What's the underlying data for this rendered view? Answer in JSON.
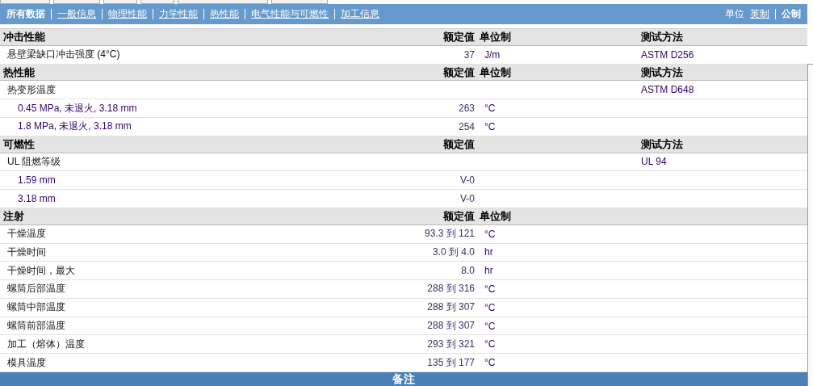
{
  "nav": {
    "items": [
      {
        "label": "所有数据",
        "selected": true
      },
      {
        "label": "一般信息",
        "selected": false
      },
      {
        "label": "物理性能",
        "selected": false
      },
      {
        "label": "力学性能",
        "selected": false
      },
      {
        "label": "热性能",
        "selected": false
      },
      {
        "label": "电气性能与可燃性",
        "selected": false
      },
      {
        "label": "加工信息",
        "selected": false
      }
    ],
    "units_label": "单位",
    "units": [
      {
        "label": "英制",
        "selected": false
      },
      {
        "label": "公制",
        "selected": true
      }
    ]
  },
  "sections": [
    {
      "title": "冲击性能",
      "value_header": "额定值",
      "unit_header": "单位制",
      "method_header": "测试方法",
      "rows": [
        {
          "name": "悬壁梁缺口冲击强度 (4°C)",
          "value": "37",
          "unit": "J/m",
          "method": "ASTM D256"
        }
      ]
    },
    {
      "title": "热性能",
      "value_header": "额定值",
      "unit_header": "单位制",
      "method_header": "测试方法",
      "rows": [
        {
          "name": "热变形温度",
          "method": "ASTM D648",
          "children": [
            {
              "name": "0.45 MPa, 未退火, 3.18 mm",
              "value": "263",
              "unit": "°C"
            },
            {
              "name": "1.8 MPa, 未退火, 3.18 mm",
              "value": "254",
              "unit": "°C"
            }
          ]
        }
      ]
    },
    {
      "title": "可燃性",
      "value_header": "额定值",
      "method_header": "测试方法",
      "rows": [
        {
          "name": "UL 阻燃等级",
          "method": "UL 94",
          "children": [
            {
              "name": "1.59 mm",
              "value": "V-0"
            },
            {
              "name": "3.18 mm",
              "value": "V-0"
            }
          ]
        }
      ]
    },
    {
      "title": "注射",
      "value_header": "额定值",
      "unit_header": "单位制",
      "rows": [
        {
          "name": "干燥温度",
          "value": "93.3 到  121",
          "unit": "°C"
        },
        {
          "name": "干燥时间",
          "value": "3.0 到  4.0",
          "unit": "hr"
        },
        {
          "name": "干燥时间，最大",
          "value": "8.0",
          "unit": "hr"
        },
        {
          "name": "螺筒后部温度",
          "value": "288 到  316",
          "unit": "°C"
        },
        {
          "name": "螺筒中部温度",
          "value": "288 到  307",
          "unit": "°C"
        },
        {
          "name": "螺筒前部温度",
          "value": "288 到  307",
          "unit": "°C"
        },
        {
          "name": "加工（熔体）温度",
          "value": "293 到  321",
          "unit": "°C"
        },
        {
          "name": "模具温度",
          "value": "135 到  177",
          "unit": "°C"
        }
      ]
    }
  ],
  "footer": {
    "title": "备注"
  }
}
